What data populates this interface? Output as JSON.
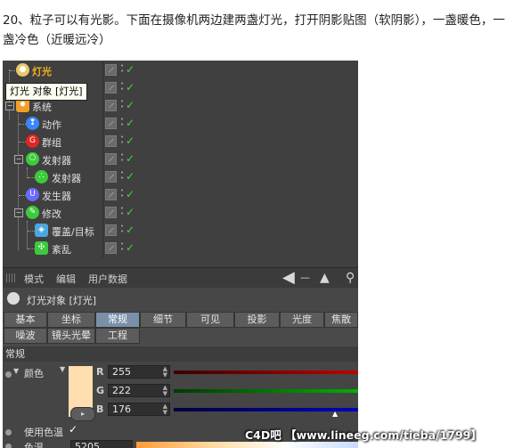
{
  "caption": "20、粒子可以有光影。下面在摄像机两边建两盏灯光，打开阴影贴图（软阴影），一盏暖色，一盏冷色（近暖远冷）",
  "tooltip": "灯光 对象 [灯光]",
  "tree": [
    {
      "label": "灯光",
      "icon": "light-bulb-icon",
      "color": "#d9a018",
      "highlight": true
    },
    {
      "label": "系统",
      "icon": "system-gear-icon",
      "color": "#f0a02a"
    },
    {
      "label": "动作",
      "icon": "action-icon",
      "color": "#3a86ff"
    },
    {
      "label": "群组",
      "icon": "group-icon",
      "color": "#e02525"
    },
    {
      "label": "发射器",
      "icon": "emitter-icon",
      "color": "#3ccb3c"
    },
    {
      "label": "发射器",
      "icon": "emitter-sub-icon",
      "color": "#3ccb3c"
    },
    {
      "label": "发生器",
      "icon": "generator-icon",
      "color": "#6a6aff"
    },
    {
      "label": "修改",
      "icon": "modifier-icon",
      "color": "#3ccb3c"
    },
    {
      "label": "覆盖/目标",
      "icon": "cover-target-icon",
      "color": "#4aa8e0"
    },
    {
      "label": "紊乱",
      "icon": "turbulence-icon",
      "color": "#3ccb3c"
    }
  ],
  "menubar": {
    "items": [
      "模式",
      "编辑",
      "用户数据"
    ]
  },
  "object_title": "灯光对象 [灯光]",
  "tabs_row1": [
    "基本",
    "坐标",
    "常规",
    "细节",
    "可见",
    "投影",
    "光度",
    "焦散"
  ],
  "tabs_row2": [
    "噪波",
    "镜头光晕",
    "工程"
  ],
  "active_tab": "常规",
  "section_header": "常规",
  "color": {
    "label": "颜色",
    "swatch": "#ffdeb0",
    "r_label": "R",
    "r": "255",
    "g_label": "G",
    "g": "222",
    "b_label": "B",
    "b": "176"
  },
  "use_temp": {
    "label": "使用色温",
    "checked": "✓"
  },
  "temp": {
    "label": "色温",
    "value": "5205"
  },
  "watermark": "C4D吧  【www.lineeg.com/tieba/1799】"
}
